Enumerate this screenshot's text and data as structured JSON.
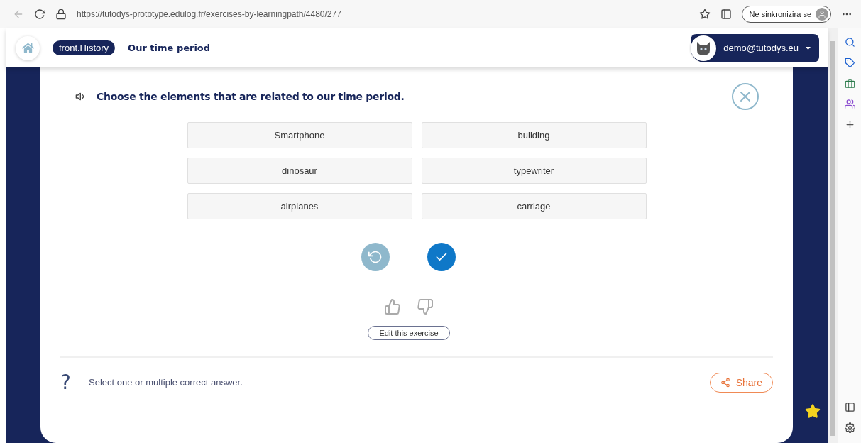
{
  "browser": {
    "url": "https://tutodys-prototype.edulog.fr/exercises-by-learningpath/4480/277",
    "sync_label": "Ne sinkronizira se"
  },
  "header": {
    "tag": "front.History",
    "title": "Our time period",
    "user": "demo@tutodys.eu"
  },
  "exercise": {
    "question": "Choose the elements that are related to our time period.",
    "options": [
      {
        "label": "Smartphone",
        "selected": false
      },
      {
        "label": "building",
        "selected": false
      },
      {
        "label": "dinosaur",
        "selected": false
      },
      {
        "label": "typewriter",
        "selected": false
      },
      {
        "label": "airplanes",
        "selected": false
      },
      {
        "label": "carriage",
        "selected": false
      }
    ],
    "edit_button": "Edit this exercise"
  },
  "footer": {
    "help_mark": "?",
    "hint": "Select one or multiple correct answer.",
    "share": "Share"
  }
}
